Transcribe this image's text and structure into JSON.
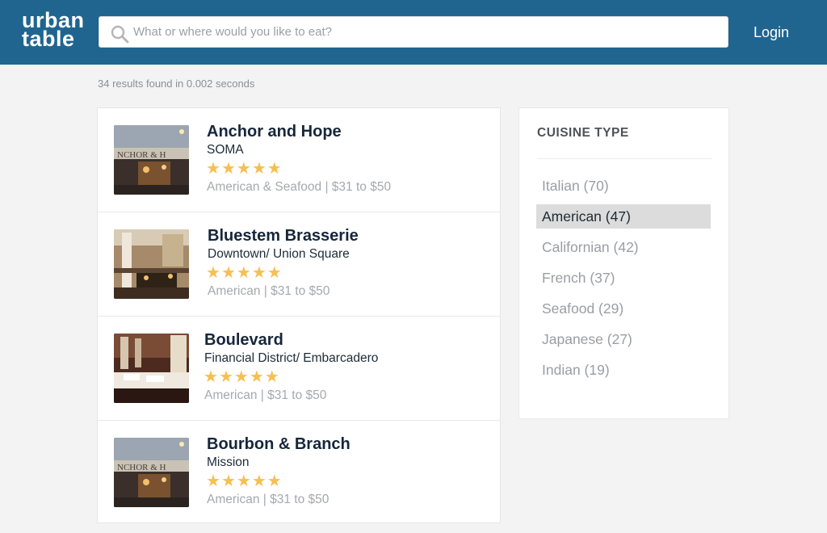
{
  "header": {
    "logo_line1": "urban",
    "logo_line2": "table",
    "search_placeholder": "What or where would you like to eat?",
    "login_label": "Login",
    "brand_color": "#1f6590"
  },
  "results_info": "34 results found in 0.002 seconds",
  "restaurants": [
    {
      "name": "Anchor and Hope",
      "area": "SOMA",
      "rating": 5,
      "details": "American & Seafood | $31 to $50",
      "thumbnail": "storefront-photo"
    },
    {
      "name": "Bluestem Brasserie",
      "area": "Downtown/ Union Square",
      "rating": 5,
      "details": "American | $31 to $50",
      "thumbnail": "interior-photo"
    },
    {
      "name": "Boulevard",
      "area": "Financial District/ Embarcadero",
      "rating": 5,
      "details": "American | $31 to $50",
      "thumbnail": "dining-room-photo"
    },
    {
      "name": "Bourbon & Branch",
      "area": "Mission",
      "rating": 5,
      "details": "American  | $31 to $50",
      "thumbnail": "storefront-photo"
    }
  ],
  "filters": {
    "title": "CUISINE TYPE",
    "items": [
      {
        "label": "Italian (70)",
        "active": false
      },
      {
        "label": "American (47)",
        "active": true
      },
      {
        "label": "Californian (42)",
        "active": false
      },
      {
        "label": "French (37)",
        "active": false
      },
      {
        "label": "Seafood (29)",
        "active": false
      },
      {
        "label": "Japanese (27)",
        "active": false
      },
      {
        "label": "Indian (19)",
        "active": false
      }
    ]
  },
  "colors": {
    "star": "#f7bf4f",
    "active_filter_bg": "#dcdcdc"
  }
}
